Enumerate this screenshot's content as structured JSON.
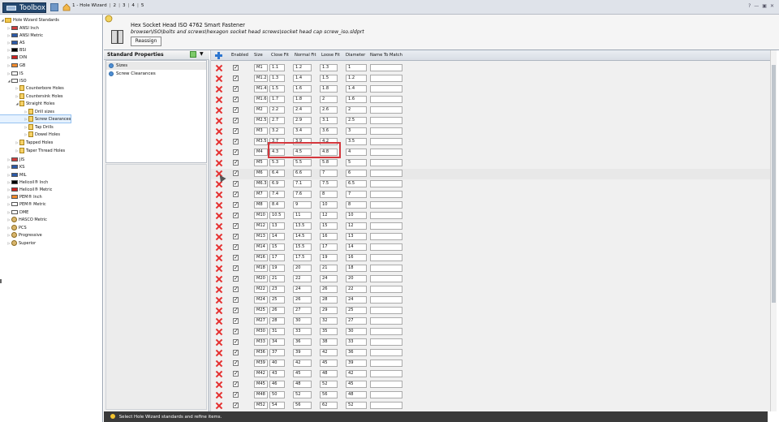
{
  "titlebar": {
    "app_label": "Toolbox",
    "breadcrumbs": [
      "1 - Hole Wizard",
      "2",
      "3",
      "4",
      "5"
    ],
    "window_controls": [
      "?",
      "—",
      "▣",
      "✕"
    ]
  },
  "tree": {
    "items": [
      {
        "label": "Hole Wizard Standards",
        "icon": "folder-icon",
        "expanded": "open"
      },
      {
        "label": "ANSI Inch",
        "icon": "us-flag-icon"
      },
      {
        "label": "ANSI Metric",
        "icon": "us-flag-icon"
      },
      {
        "label": "AS",
        "icon": "au-flag-icon"
      },
      {
        "label": "BSI",
        "icon": "uk-flag-icon"
      },
      {
        "label": "DIN",
        "icon": "de-flag-icon"
      },
      {
        "label": "GB",
        "icon": "cn-flag-icon"
      },
      {
        "label": "IS",
        "icon": "in-flag-icon"
      },
      {
        "label": "ISO",
        "icon": "iso-flag-icon",
        "expanded": "open"
      },
      {
        "label": "Counterbore Holes",
        "icon": "hole-icon"
      },
      {
        "label": "Countersink Holes",
        "icon": "hole-icon"
      },
      {
        "label": "Straight Holes",
        "icon": "hole-icon",
        "expanded": "open"
      },
      {
        "label": "Drill sizes",
        "icon": "hole-icon"
      },
      {
        "label": "Screw Clearances",
        "icon": "hole-icon",
        "selected": true
      },
      {
        "label": "Tap Drills",
        "icon": "hole-icon"
      },
      {
        "label": "Dowel Holes",
        "icon": "hole-icon"
      },
      {
        "label": "Tapped Holes",
        "icon": "hole-icon"
      },
      {
        "label": "Taper Thread Holes",
        "icon": "hole-icon"
      },
      {
        "label": "JIS",
        "icon": "jp-flag-icon"
      },
      {
        "label": "KS",
        "icon": "kr-flag-icon"
      },
      {
        "label": "MIL",
        "icon": "us-flag-icon"
      },
      {
        "label": "Helicoil® Inch",
        "icon": "helicoil-icon"
      },
      {
        "label": "Helicoil® Metric",
        "icon": "helicoil-icon"
      },
      {
        "label": "PEM® Inch",
        "icon": "pem-icon"
      },
      {
        "label": "PEM® Metric",
        "icon": "pem-icon"
      },
      {
        "label": "DME",
        "icon": "dme-icon"
      },
      {
        "label": "HASCO Metric",
        "icon": "person-icon"
      },
      {
        "label": "PCS",
        "icon": "person-icon"
      },
      {
        "label": "Progressive",
        "icon": "person-icon"
      },
      {
        "label": "Superior",
        "icon": "person-icon"
      }
    ]
  },
  "header": {
    "fastener_title": "Hex Socket Head ISO 4762 Smart Fastener",
    "fastener_path": "browser\\ISO\\bolts and screws\\hexagon socket head screws\\socket head cap screw_iso.sldprt",
    "reassign_label": "Reassign"
  },
  "props": {
    "title": "Standard Properties",
    "items": [
      "Sizes",
      "Screw Clearances"
    ]
  },
  "grid": {
    "headers": [
      "Enabled",
      "Size",
      "Close Fit",
      "Normal Fit",
      "Loose Fit",
      "Diameter",
      "Name To Match"
    ],
    "rows": [
      {
        "size": "M1",
        "close": "1.1",
        "normal": "1.2",
        "loose": "1.3",
        "diameter": "1"
      },
      {
        "size": "M1.2",
        "close": "1.3",
        "normal": "1.4",
        "loose": "1.5",
        "diameter": "1.2"
      },
      {
        "size": "M1.4",
        "close": "1.5",
        "normal": "1.6",
        "loose": "1.8",
        "diameter": "1.4"
      },
      {
        "size": "M1.6",
        "close": "1.7",
        "normal": "1.8",
        "loose": "2",
        "diameter": "1.6"
      },
      {
        "size": "M2",
        "close": "2.2",
        "normal": "2.4",
        "loose": "2.6",
        "diameter": "2"
      },
      {
        "size": "M2.5",
        "close": "2.7",
        "normal": "2.9",
        "loose": "3.1",
        "diameter": "2.5"
      },
      {
        "size": "M3",
        "close": "3.2",
        "normal": "3.4",
        "loose": "3.6",
        "diameter": "3"
      },
      {
        "size": "M3.5",
        "close": "3.7",
        "normal": "3.9",
        "loose": "4.2",
        "diameter": "3.5"
      },
      {
        "size": "M4",
        "close": "4.3",
        "normal": "4.5",
        "loose": "4.8",
        "diameter": "4"
      },
      {
        "size": "M5",
        "close": "5.3",
        "normal": "5.5",
        "loose": "5.8",
        "diameter": "5"
      },
      {
        "size": "M6",
        "close": "6.4",
        "normal": "6.6",
        "loose": "7",
        "diameter": "6"
      },
      {
        "size": "M6.3",
        "close": "6.9",
        "normal": "7.1",
        "loose": "7.5",
        "diameter": "6.5"
      },
      {
        "size": "M7",
        "close": "7.4",
        "normal": "7.6",
        "loose": "8",
        "diameter": "7"
      },
      {
        "size": "M8",
        "close": "8.4",
        "normal": "9",
        "loose": "10",
        "diameter": "8"
      },
      {
        "size": "M10",
        "close": "10.5",
        "normal": "11",
        "loose": "12",
        "diameter": "10"
      },
      {
        "size": "M12",
        "close": "13",
        "normal": "13.5",
        "loose": "15",
        "diameter": "12"
      },
      {
        "size": "M13",
        "close": "14",
        "normal": "14.5",
        "loose": "16",
        "diameter": "13"
      },
      {
        "size": "M14",
        "close": "15",
        "normal": "15.5",
        "loose": "17",
        "diameter": "14"
      },
      {
        "size": "M16",
        "close": "17",
        "normal": "17.5",
        "loose": "19",
        "diameter": "16"
      },
      {
        "size": "M18",
        "close": "19",
        "normal": "20",
        "loose": "21",
        "diameter": "18"
      },
      {
        "size": "M20",
        "close": "21",
        "normal": "22",
        "loose": "24",
        "diameter": "20"
      },
      {
        "size": "M22",
        "close": "23",
        "normal": "24",
        "loose": "26",
        "diameter": "22"
      },
      {
        "size": "M24",
        "close": "25",
        "normal": "26",
        "loose": "28",
        "diameter": "24"
      },
      {
        "size": "M25",
        "close": "26",
        "normal": "27",
        "loose": "29",
        "diameter": "25"
      },
      {
        "size": "M27",
        "close": "28",
        "normal": "30",
        "loose": "32",
        "diameter": "27"
      },
      {
        "size": "M30",
        "close": "31",
        "normal": "33",
        "loose": "35",
        "diameter": "30"
      },
      {
        "size": "M33",
        "close": "34",
        "normal": "36",
        "loose": "38",
        "diameter": "33"
      },
      {
        "size": "M36",
        "close": "37",
        "normal": "39",
        "loose": "42",
        "diameter": "36"
      },
      {
        "size": "M39",
        "close": "40",
        "normal": "42",
        "loose": "45",
        "diameter": "39"
      },
      {
        "size": "M42",
        "close": "43",
        "normal": "45",
        "loose": "48",
        "diameter": "42"
      },
      {
        "size": "M45",
        "close": "46",
        "normal": "48",
        "loose": "52",
        "diameter": "45"
      },
      {
        "size": "M48",
        "close": "50",
        "normal": "52",
        "loose": "56",
        "diameter": "48"
      },
      {
        "size": "M52",
        "close": "54",
        "normal": "56",
        "loose": "62",
        "diameter": "52"
      }
    ]
  },
  "status": {
    "text": "Select Hole Wizard standards and refine items."
  }
}
